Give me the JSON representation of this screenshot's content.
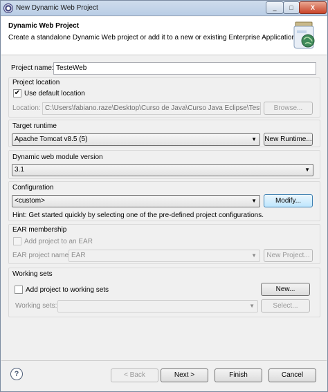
{
  "window": {
    "title": "New Dynamic Web Project",
    "minimize_glyph": "_",
    "maximize_glyph": "□",
    "close_glyph": "X"
  },
  "header": {
    "title": "Dynamic Web Project",
    "description": "Create a standalone Dynamic Web project or add it to a new or existing Enterprise Application."
  },
  "project_name": {
    "label": "Project name:",
    "value": "TesteWeb"
  },
  "location": {
    "section_label": "Project location",
    "use_default_label": "Use default location",
    "use_default_checked": true,
    "location_label": "Location:",
    "location_value": "C:\\Users\\fabiano.raze\\Desktop\\Curso de Java\\Curso Java Eclipse\\TesteWeb",
    "browse_label": "Browse..."
  },
  "target_runtime": {
    "label": "Target runtime",
    "selected": "Apache Tomcat v8.5 (5)",
    "new_runtime_label": "New Runtime..."
  },
  "module_version": {
    "label": "Dynamic web module version",
    "selected": "3.1"
  },
  "configuration": {
    "label": "Configuration",
    "selected": "<custom>",
    "modify_label": "Modify...",
    "hint": "Hint: Get started quickly by selecting one of the pre-defined project configurations."
  },
  "ear": {
    "label": "EAR membership",
    "add_label": "Add project to an EAR",
    "project_name_label": "EAR project name:",
    "project_name_value": "EAR",
    "new_project_label": "New Project..."
  },
  "working_sets": {
    "label": "Working sets",
    "add_label": "Add project to working sets",
    "new_label": "New...",
    "sets_label": "Working sets:",
    "select_label": "Select..."
  },
  "footer": {
    "help_glyph": "?",
    "back_label": "< Back",
    "next_label": "Next >",
    "finish_label": "Finish",
    "cancel_label": "Cancel"
  },
  "icons": {
    "app": "eclipse-icon",
    "wizard": "web-project-jar-icon",
    "help": "help-icon",
    "dropdown": "chevron-down-icon"
  }
}
